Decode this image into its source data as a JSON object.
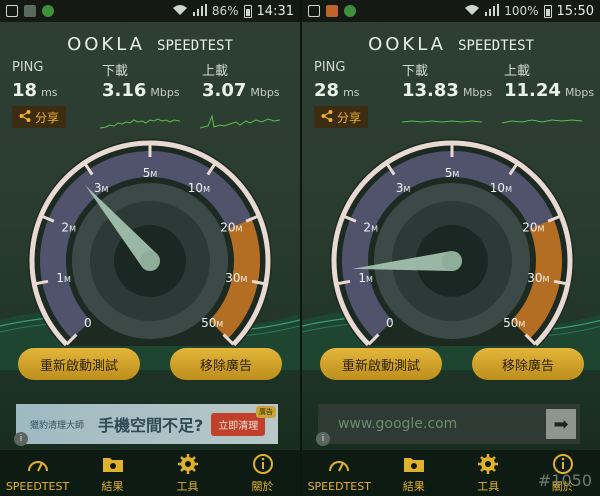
{
  "colors": {
    "accent": "#e3b63a",
    "gauge_rim": "#e8d9d3",
    "gauge_fill_upper": "#cf7a25",
    "needle": "#a9c7b4",
    "sparkline": "#5fbf4a"
  },
  "brand": {
    "logo": "OOKLA",
    "name": "SPEEDTEST"
  },
  "panels": [
    {
      "status": {
        "battery": "86%",
        "time": "14:31"
      },
      "ping": {
        "label": "PING",
        "value": "18",
        "unit": "ms"
      },
      "download": {
        "label": "下載",
        "value": "3.16",
        "unit": "Mbps"
      },
      "upload": {
        "label": "上載",
        "value": "3.07",
        "unit": "Mbps"
      },
      "share_label": "分享",
      "restart_label": "重新啟動測試",
      "remove_ads_label": "移除廣告",
      "ad": {
        "brand": "獵豹清理大師",
        "headline": "手機空間不足?",
        "cta": "立即清理",
        "badge": "廣告"
      },
      "needle_value": 2.8
    },
    {
      "status": {
        "battery": "100%",
        "time": "15:50"
      },
      "ping": {
        "label": "PING",
        "value": "28",
        "unit": "ms"
      },
      "download": {
        "label": "下載",
        "value": "13.83",
        "unit": "Mbps"
      },
      "upload": {
        "label": "上載",
        "value": "11.24",
        "unit": "Mbps"
      },
      "share_label": "分享",
      "restart_label": "重新啟動測試",
      "remove_ads_label": "移除廣告",
      "ad": {
        "url": "www.google.com",
        "arrow": "➡"
      },
      "needle_value": 1.2
    }
  ],
  "gauge": {
    "ticks": [
      {
        "label": "0",
        "unit": ""
      },
      {
        "label": "1",
        "unit": "M"
      },
      {
        "label": "2",
        "unit": "M"
      },
      {
        "label": "3",
        "unit": "M"
      },
      {
        "label": "5",
        "unit": "M"
      },
      {
        "label": "10",
        "unit": "M"
      },
      {
        "label": "20",
        "unit": "M"
      },
      {
        "label": "30",
        "unit": "M"
      },
      {
        "label": "50",
        "unit": "M"
      }
    ]
  },
  "tabs": [
    {
      "label": "SPEEDTEST",
      "icon": "gauge-icon"
    },
    {
      "label": "結果",
      "icon": "folder-icon"
    },
    {
      "label": "工具",
      "icon": "gear-icon"
    },
    {
      "label": "關於",
      "icon": "info-icon"
    }
  ],
  "watermark": "#1050"
}
